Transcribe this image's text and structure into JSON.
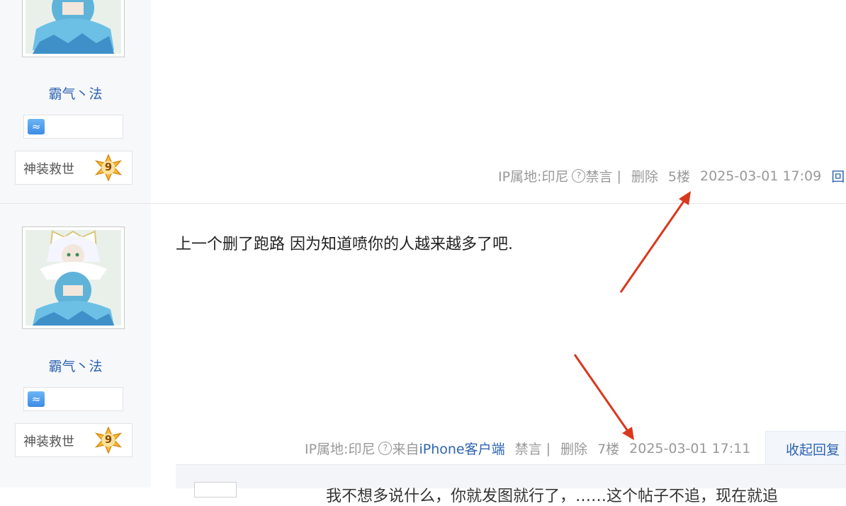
{
  "posts": [
    {
      "user": {
        "name": "霸气丶法",
        "level_title": "神装救世",
        "level": "9",
        "badge_icon": "aquarius-icon"
      },
      "content": "",
      "tail": {
        "ip": "IP属地:印尼",
        "source_prefix": "",
        "source_link": "",
        "ban": "禁言",
        "delete": "删除",
        "floor": "5楼",
        "time": "2025-03-01 17:09",
        "reply": "回"
      }
    },
    {
      "user": {
        "name": "霸气丶法",
        "level_title": "神装救世",
        "level": "9",
        "badge_icon": "aquarius-icon"
      },
      "content": "上一个删了跑路 因为知道喷你的人越来越多了吧.",
      "tail": {
        "ip": "IP属地:印尼",
        "source_prefix": "来自",
        "source_link": "iPhone客户端",
        "ban": "禁言",
        "delete": "删除",
        "floor": "7楼",
        "time": "2025-03-01 17:11",
        "reply": "收起回复"
      },
      "subreply_preview": "我不想多说什么，你就发图就行了，……这个帖子不追，现在就追"
    }
  ],
  "separator": "|",
  "colors": {
    "link": "#2d64b3",
    "annotation_arrow": "#d9381e",
    "sidebar_bg": "#f7f8fa"
  }
}
